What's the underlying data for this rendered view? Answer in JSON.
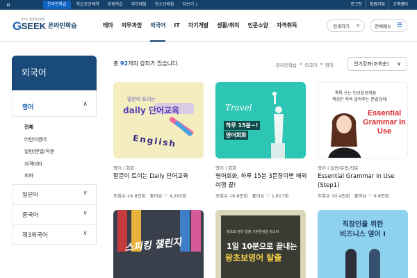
{
  "topbar": {
    "tabs": [
      {
        "label": "온라인학습",
        "active": true
      },
      {
        "label": "학습공간예약"
      },
      {
        "label": "회원학습"
      },
      {
        "label": "부모배움"
      },
      {
        "label": "청소년배움"
      },
      {
        "label": "더보기"
      }
    ],
    "right": [
      "로그인",
      "회원가입",
      "고객센터"
    ]
  },
  "header": {
    "logo_sub": "경기도 평생학습포털",
    "logo_g": "G",
    "logo_seek": "SEEK",
    "logo_online": "온라인학습",
    "gnb": [
      {
        "label": "테마"
      },
      {
        "label": "의무과정"
      },
      {
        "label": "외국어",
        "active": true
      },
      {
        "label": "IT"
      },
      {
        "label": "자기개발"
      },
      {
        "label": "생활/취미"
      },
      {
        "label": "인문소양"
      },
      {
        "label": "자격취득"
      }
    ],
    "search_label": "검색하기",
    "menu_label": "전체메뉴"
  },
  "sidebar": {
    "title": "외국어",
    "main": {
      "label": "영어"
    },
    "subs": [
      {
        "label": "전체",
        "active": true
      },
      {
        "label": "어린이영어"
      },
      {
        "label": "일반/문법/작문"
      },
      {
        "label": "자격대비"
      },
      {
        "label": "회화"
      }
    ],
    "cats": [
      {
        "label": "일본어"
      },
      {
        "label": "중국어"
      },
      {
        "label": "제3외국어"
      }
    ]
  },
  "content": {
    "count_prefix": "총 ",
    "count": "92",
    "count_suffix": "개의 강좌가 있습니다.",
    "breadcrumb": [
      "온라인학습",
      ">",
      "외국어",
      ">",
      "영어"
    ],
    "sort_label": "인기강좌(조회순)"
  },
  "cards": [
    {
      "category": "영어 | 회화",
      "title": "말문이 트이는 Daily 단어교육",
      "views": "조회수 24.8만회",
      "likes_label": "좋아요",
      "likes": "4,295회",
      "thumb": {
        "bubble": "말문이 트이는",
        "big": "daily 단어교육",
        "eng": "English"
      }
    },
    {
      "category": "영어 | 회화",
      "title": "영어회화, 하루 15분 3문장이면 해외여행 끝!",
      "views": "조회수 16.8만회",
      "likes_label": "좋아요",
      "likes": "1,817회",
      "thumb": {
        "travel": "Travel",
        "l1": "하루 15분~!",
        "l2": "영어회화"
      }
    },
    {
      "category": "영어 | 일반/문법/작문",
      "title": "Essential Grammar In Use (Step1)",
      "views": "조회수 10.4만회",
      "likes_label": "좋아요",
      "likes": "9.8만회",
      "thumb": {
        "top1": "톡톡 쏘는 탄산음료처럼",
        "top2": "핵심만 쏙쏙 알려주는 문법강의!",
        "eg": "Essential Grammar In Use"
      }
    },
    {
      "thumb": {
        "title": "스피킹 챌린지"
      }
    },
    {
      "thumb": {
        "small": "왕초보 영어 탈출 기본문장을 마스터",
        "l1": "1일 10분으로 끝내는",
        "l2": "왕초보영어 탈출"
      }
    },
    {
      "thumb": {
        "l1": "직장인을 위한",
        "l2": "비즈니스 영어 I"
      }
    }
  ],
  "icons": {
    "home": "home-icon",
    "search": "search-icon",
    "menu": "hamburger-icon",
    "chevron": "chevron-down-icon",
    "heart": "heart-icon"
  },
  "colors": {
    "topbar": "#14406a",
    "accent": "#1a5fb4",
    "sidebar_head": "#1a4a79"
  }
}
